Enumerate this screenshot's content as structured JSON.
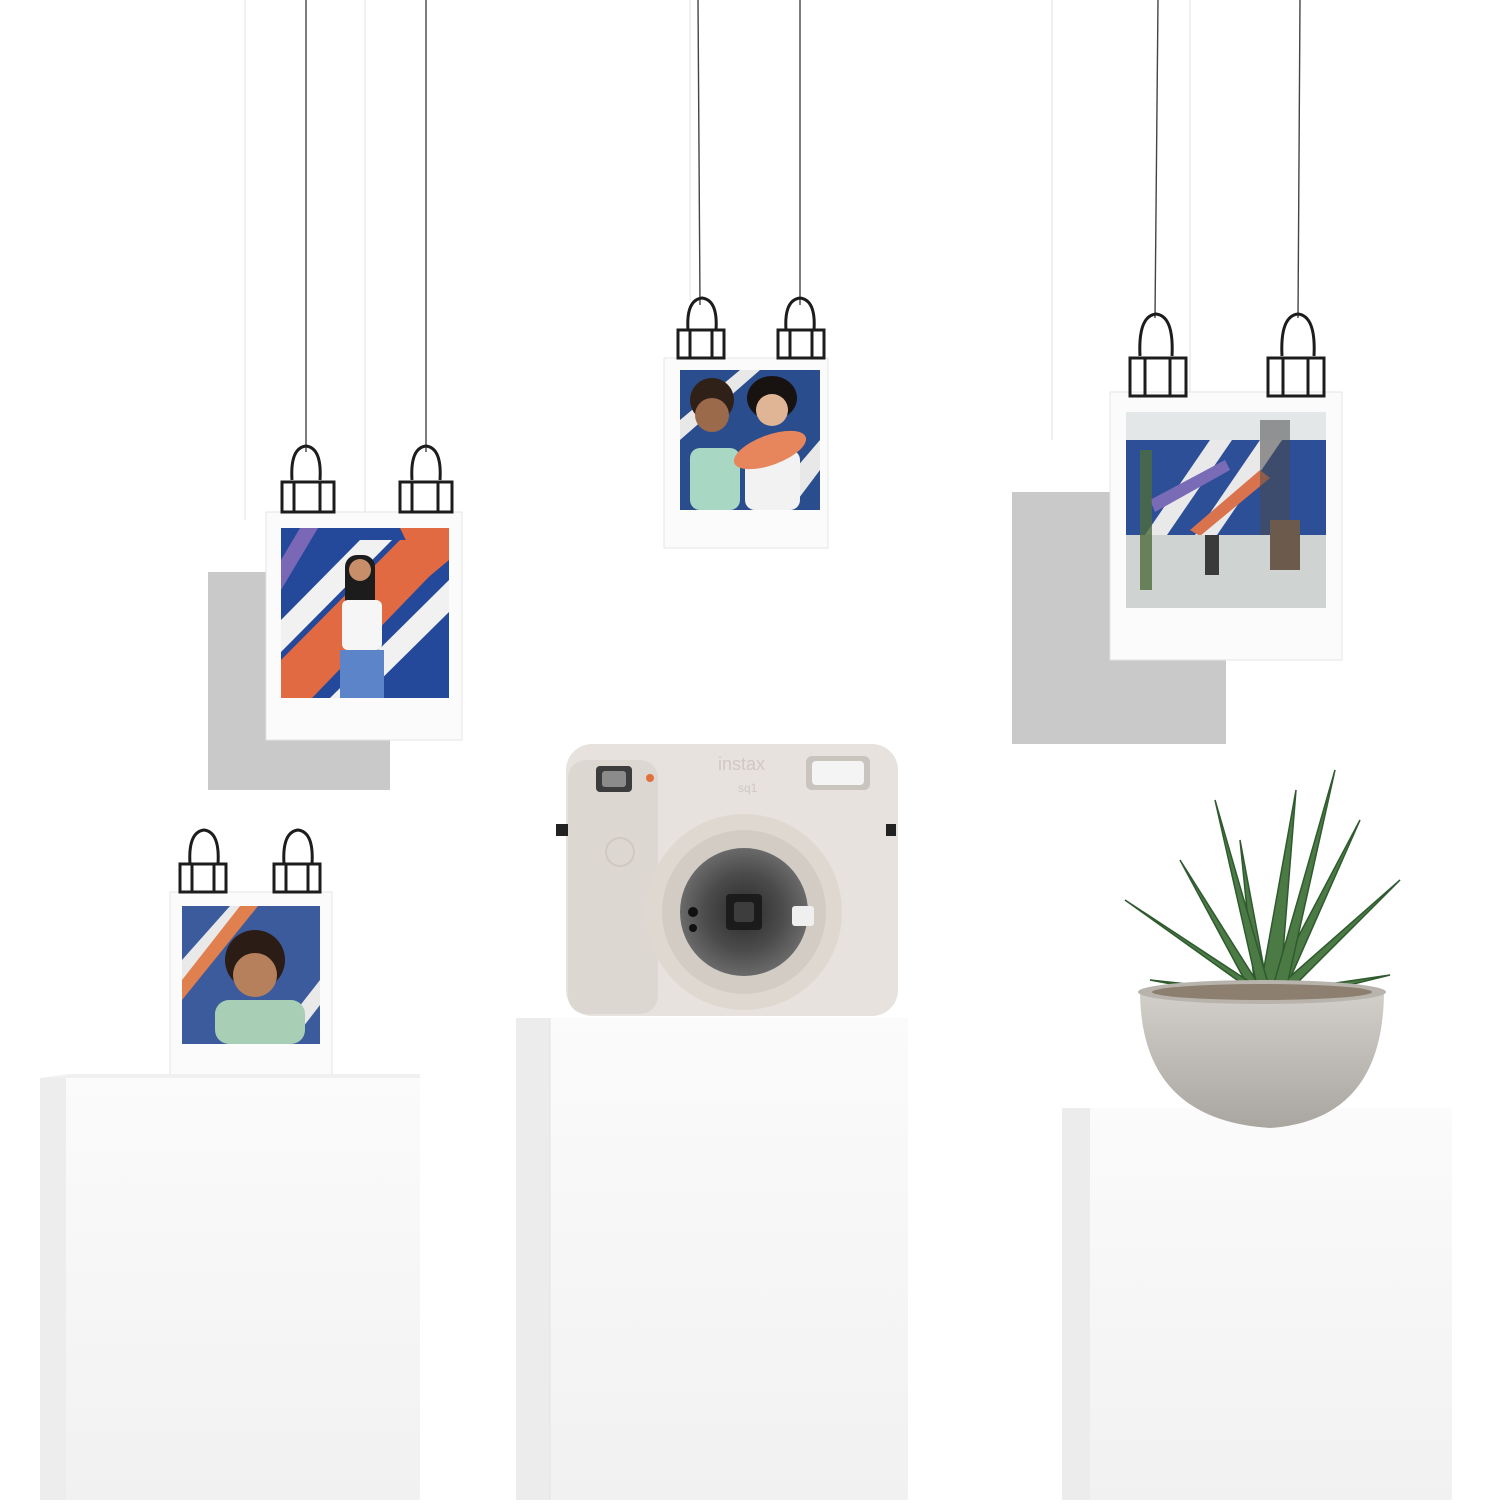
{
  "scene": {
    "description_free": true,
    "colors": {
      "background": "#ffffff",
      "wall_shadow": "#c9c9c9",
      "pedestal": "#f6f6f6",
      "pedestal_side": "#ebebeb",
      "camera_body": "#e6e1dc",
      "camera_dark": "#505050",
      "plant_green": "#3f6b3a",
      "pot": "#c7c4bf",
      "clip": "#1c1c1c"
    }
  },
  "camera": {
    "brand": "instax",
    "model": "sq1",
    "lens_icon": "lens-icon",
    "flash_icon": "flash-icon"
  },
  "photos": [
    {
      "name": "photo-woman-painting-wall",
      "palette": [
        "#1f3f8f",
        "#e06b45",
        "#f4f4f4"
      ]
    },
    {
      "name": "photo-two-friends",
      "palette": [
        "#2c4a8c",
        "#e8825a",
        "#9fd1bf"
      ]
    },
    {
      "name": "photo-studio-mural",
      "palette": [
        "#2b4f97",
        "#e6e4df",
        "#8a6d5c"
      ]
    },
    {
      "name": "photo-selfie-woman",
      "palette": [
        "#3a5a9a",
        "#a7cfb7",
        "#c78a63"
      ]
    }
  ],
  "plant": {
    "type": "succulent",
    "pot": "concrete-bowl"
  }
}
